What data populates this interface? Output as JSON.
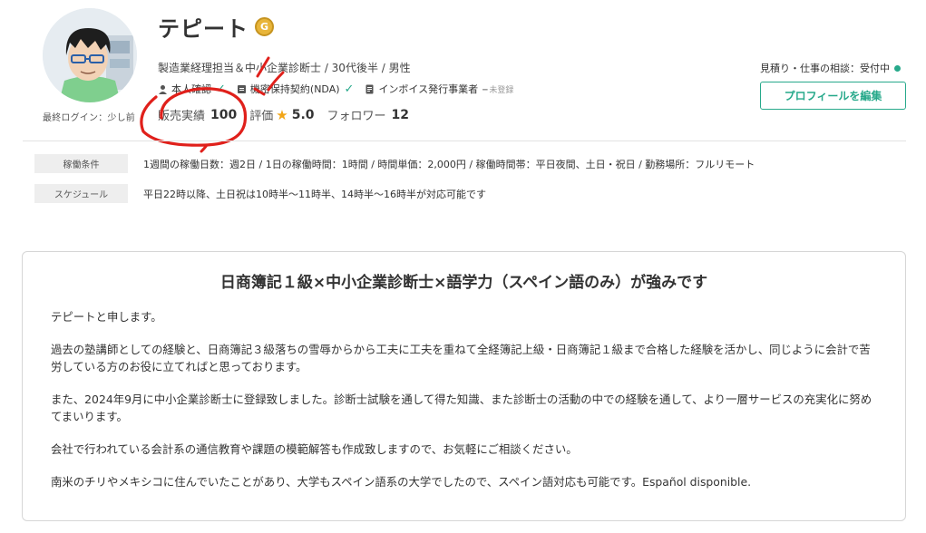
{
  "profile": {
    "name": "テピート",
    "rank_badge": "G",
    "job_title": "製造業経理担当＆中小企業診断士 / 30代後半 / 男性",
    "last_login": "最終ログイン：少し前",
    "verifications": [
      {
        "label": "本人確認",
        "icon": "person-icon",
        "verified": true
      },
      {
        "label": "機密保持契約(NDA)",
        "icon": "document-icon",
        "verified": true
      },
      {
        "label": "インボイス発行事業者",
        "icon": "invoice-icon",
        "status": "未登録"
      }
    ],
    "stats": {
      "sales_label": "販売実績",
      "sales_value": "100",
      "rating_label": "評価",
      "rating_value": "5.0",
      "followers_label": "フォロワー",
      "followers_value": "12"
    },
    "consult_status": "見積り・仕事の相談：受付中",
    "edit_button": "プロフィールを編集"
  },
  "conditions": [
    {
      "label": "稼働条件",
      "text": "1週間の稼働日数：週2日  /  1日の稼働時間：1時間  /  時間単価：2,000円  /  稼働時間帯：平日夜間、土日・祝日  /  勤務場所：フルリモート"
    },
    {
      "label": "スケジュール",
      "text": "平日22時以降、土日祝は10時半～11時半、14時半～16時半が対応可能です"
    }
  ],
  "intro": {
    "title": "日商簿記１級×中小企業診断士×語学力（スペイン語のみ）が強みです",
    "paragraphs": [
      "テピートと申します。",
      "過去の塾講師としての経験と、日商簿記３級落ちの雪辱からから工夫に工夫を重ねて全経簿記上級・日商簿記１級まで合格した経験を活かし、同じように会計で苦労している方のお役に立てればと思っております。",
      "また、2024年9月に中小企業診断士に登録致しました。診断士試験を通して得た知識、また診断士の活動の中での経験を通して、より一層サービスの充実化に努めてまいります。",
      "会社で行われている会計系の通信教育や課題の模範解答も作成致しますので、お気軽にご相談ください。",
      "南米のチリやメキシコに住んでいたことがあり、大学もスペイン語系の大学でしたので、スペイン語対応も可能です。Español disponible."
    ]
  },
  "colors": {
    "accent": "#27a98b",
    "star": "#f2a516",
    "annotation": "#e0201b",
    "badge_gold": "#e8b53a"
  }
}
